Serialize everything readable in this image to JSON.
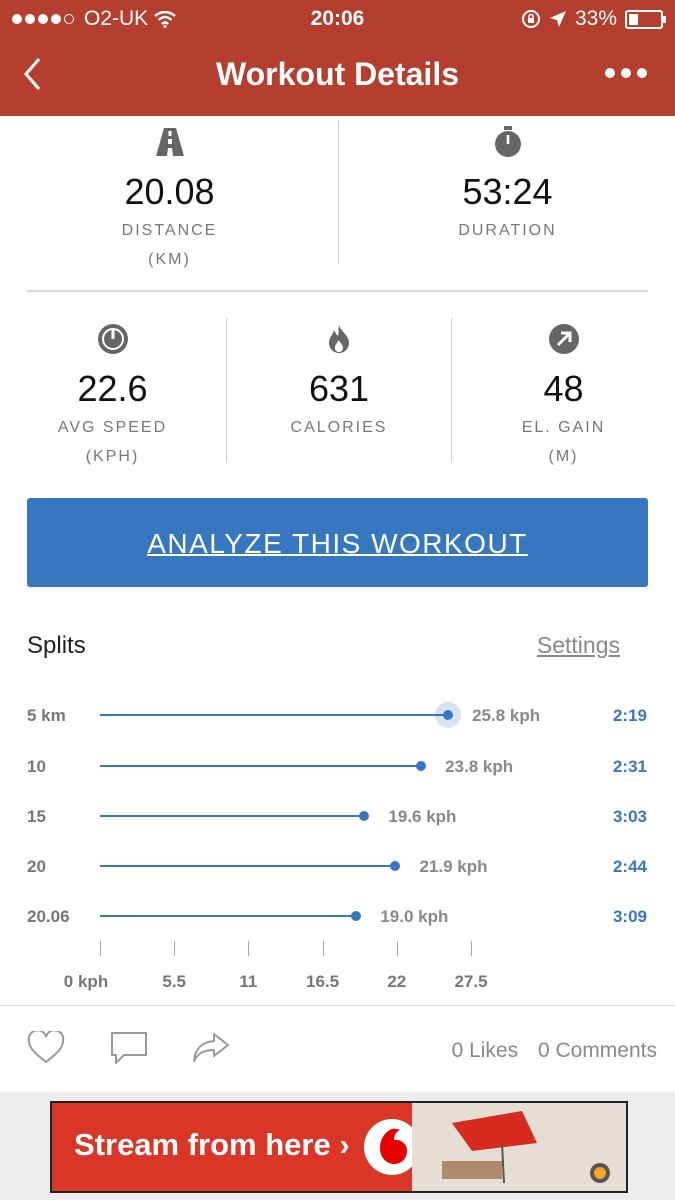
{
  "status_bar": {
    "carrier": "O2-UK",
    "time": "20:06",
    "battery": "33%",
    "battery_level": 0.33,
    "signal_bars": 4
  },
  "nav": {
    "title": "Workout Details",
    "back_icon": "chevron-left-icon",
    "more_icon": "more-dots-icon"
  },
  "stats_top": [
    {
      "icon": "road-icon",
      "value": "20.08",
      "label": "DISTANCE",
      "unit": "(KM)"
    },
    {
      "icon": "stopwatch-icon",
      "value": "53:24",
      "label": "DURATION",
      "unit": ""
    }
  ],
  "stats_bottom": [
    {
      "icon": "speedometer-icon",
      "value": "22.6",
      "label": "AVG SPEED",
      "unit": "(KPH)"
    },
    {
      "icon": "flame-icon",
      "value": "631",
      "label": "CALORIES",
      "unit": ""
    },
    {
      "icon": "elevation-arrow-icon",
      "value": "48",
      "label": "EL. GAIN",
      "unit": "(M)"
    }
  ],
  "analyze_button": "ANALYZE THIS WORKOUT",
  "splits": {
    "title": "Splits",
    "settings": "Settings",
    "rows": [
      {
        "label": "5 km",
        "speed_text": "25.8 kph",
        "time": "2:19"
      },
      {
        "label": "10",
        "speed_text": "23.8 kph",
        "time": "2:31"
      },
      {
        "label": "15",
        "speed_text": "19.6 kph",
        "time": "3:03"
      },
      {
        "label": "20",
        "speed_text": "21.9 kph",
        "time": "2:44"
      },
      {
        "label": "20.06",
        "speed_text": "19.0 kph",
        "time": "3:09"
      }
    ],
    "axis_ticks": [
      "0 kph",
      "5.5",
      "11",
      "16.5",
      "22",
      "27.5"
    ]
  },
  "chart_data": {
    "type": "bar",
    "categories": [
      "5 km",
      "10",
      "15",
      "20",
      "20.06"
    ],
    "values": [
      25.8,
      23.8,
      19.6,
      21.9,
      19.0
    ],
    "xlim": [
      0,
      27.5
    ],
    "orientation": "horizontal"
  },
  "footer": {
    "like_icon": "heart-icon",
    "comment_icon": "comment-icon",
    "share_icon": "share-icon",
    "likes": "0 Likes",
    "comments": "0 Comments"
  },
  "ad": {
    "text": "Stream from here ›",
    "logo": "vodafone-logo"
  },
  "colors": {
    "brand": "#b43f2f",
    "accent": "#3677c0",
    "ad": "#d93627"
  }
}
